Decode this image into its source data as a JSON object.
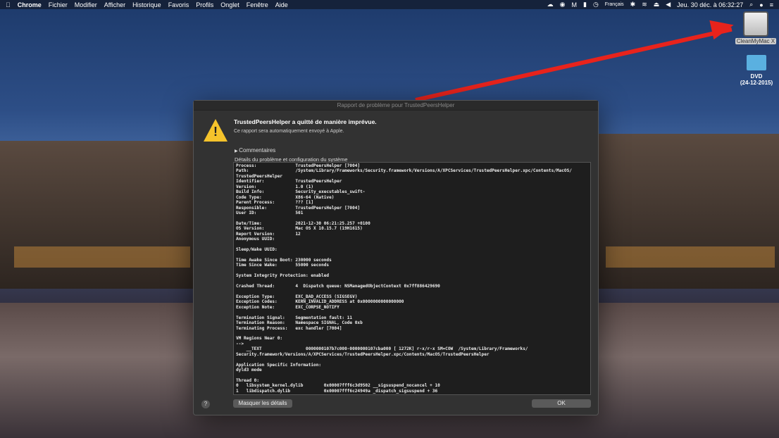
{
  "menubar": {
    "items": [
      "Chrome",
      "Fichier",
      "Modifier",
      "Afficher",
      "Historique",
      "Favoris",
      "Profils",
      "Onglet",
      "Fenêtre",
      "Aide"
    ],
    "language": "Français",
    "datetime": "Jeu. 30 déc. à 06:32:27"
  },
  "desktop": {
    "drive_label": "CleanMyMac X",
    "folder_label_1": "DVD",
    "folder_label_2": "(24-12-2015)"
  },
  "dialog": {
    "window_title": "Rapport de problème pour TrustedPeersHelper",
    "title": "TrustedPeersHelper a quitté de manière imprévue.",
    "subtitle": "Ce rapport sera automatiquement envoyé à Apple.",
    "comments": "Commentaires",
    "details_label": "Détails du problème et configuration du système",
    "hide_details": "Masquer les détails",
    "ok": "OK",
    "help": "?",
    "report": [
      "Process:               TrustedPeersHelper [7004]",
      "Path:                  /System/Library/Frameworks/Security.framework/Versions/A/XPCServices/TrustedPeersHelper.xpc/Contents/MacOS/",
      "TrustedPeersHelper",
      "Identifier:            TrustedPeersHelper",
      "Version:               1.0 (1)",
      "Build Info:            Security_executables_swift-",
      "Code Type:             X86-64 (Native)",
      "Parent Process:        ??? [1]",
      "Responsible:           TrustedPeersHelper [7004]",
      "User ID:               501",
      "",
      "Date/Time:             2021-12-30 06:21:25.257 +0100",
      "OS Version:            Mac OS X 10.15.7 (19H1615)",
      "Report Version:        12",
      "Anonymous UUID:",
      "",
      "Sleep/Wake UUID:",
      "",
      "Time Awake Since Boot: 230000 seconds",
      "Time Since Wake:       55000 seconds",
      "",
      "System Integrity Protection: enabled",
      "",
      "Crashed Thread:        4  Dispatch queue: NSManagedObjectContext 0x7ff886429690",
      "",
      "Exception Type:        EXC_BAD_ACCESS (SIGSEGV)",
      "Exception Codes:       KERN_INVALID_ADDRESS at 0x0000000000000000",
      "Exception Note:        EXC_CORPSE_NOTIFY",
      "",
      "Termination Signal:    Segmentation fault: 11",
      "Termination Reason:    Namespace SIGNAL, Code 0xb",
      "Terminating Process:   exc handler [7004]",
      "",
      "VM Regions Near 0:",
      "-->",
      "    __TEXT                 0000000107b7c000-0000000107cba000 [ 1272K] r-x/r-x SM=COW  /System/Library/Frameworks/",
      "Security.framework/Versions/A/XPCServices/TrustedPeersHelper.xpc/Contents/MacOS/TrustedPeersHelper",
      "",
      "Application Specific Information:",
      "dyld3 mode",
      "",
      "Thread 0:",
      "0   libsystem_kernel.dylib        0x00007fff6c3d9502 __sigsuspend_nocancel + 10",
      "1   libdispatch.dylib             0x00007fff6c24949a _dispatch_sigsuspend + 36"
    ]
  }
}
